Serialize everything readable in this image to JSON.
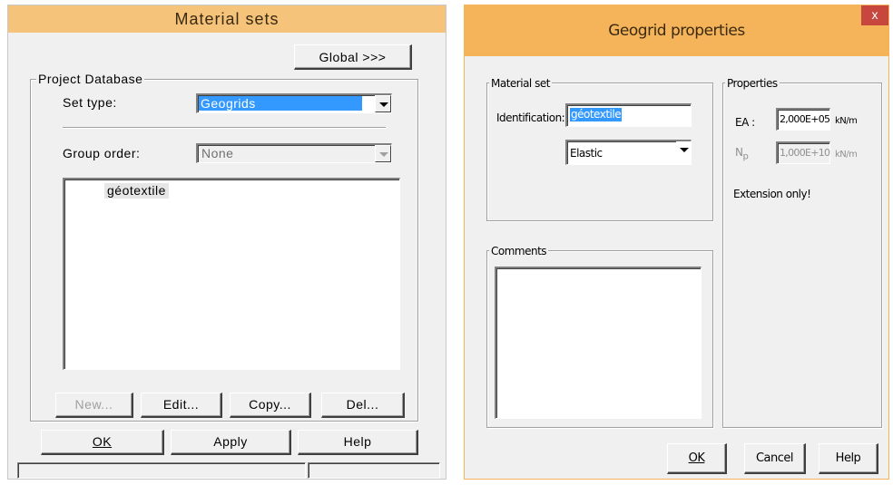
{
  "material_sets": {
    "title": "Material sets",
    "global_button": "Global >>>",
    "project_database_label": "Project Database",
    "set_type_label": "Set type:",
    "set_type_value": "Geogrids",
    "group_order_label": "Group order:",
    "group_order_value": "None",
    "list_items": [
      "géotextile"
    ],
    "buttons": {
      "new": "New...",
      "edit": "Edit...",
      "copy": "Copy...",
      "del": "Del...",
      "ok": "OK",
      "apply": "Apply",
      "help": "Help"
    }
  },
  "geogrid_properties": {
    "title": "Geogrid properties",
    "close_label": "x",
    "material_set_label": "Material set",
    "identification_label": "Identification:",
    "identification_value": "géotextile",
    "model_value": "Elastic",
    "comments_label": "Comments",
    "properties_label": "Properties",
    "ea_label": "EA :",
    "ea_value": "2,000E+05",
    "ea_unit": "kN/m",
    "np_label": "N",
    "np_subscript": "p",
    "np_value": "1,000E+10",
    "np_unit": "kN/m",
    "extension_note": "Extension only!",
    "buttons": {
      "ok": "OK",
      "cancel": "Cancel",
      "help": "Help"
    }
  },
  "colors": {
    "title_bar": "#f5c37a",
    "close_button": "#c7463e",
    "selection": "#3399ff"
  }
}
